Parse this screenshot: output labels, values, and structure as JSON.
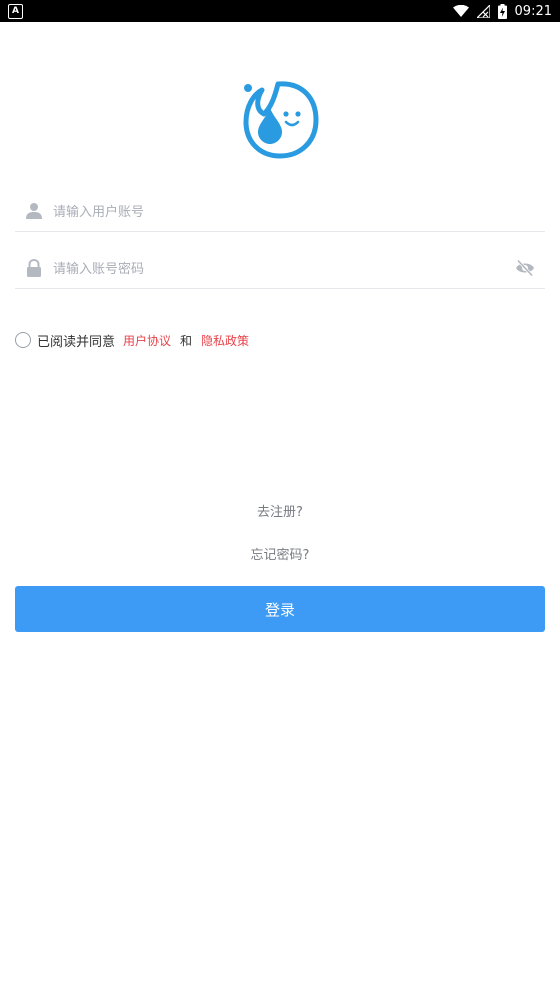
{
  "status_bar": {
    "left_indicator": "A",
    "time": "09:21",
    "icons": [
      "wifi-icon",
      "signal-icon",
      "battery-charging-icon"
    ]
  },
  "logo": {
    "icon": "water-drop-mascot-logo",
    "color": "#2a9be0"
  },
  "username": {
    "placeholder": "请输入用户账号",
    "value": "",
    "icon": "user-icon"
  },
  "password": {
    "placeholder": "请输入账号密码",
    "value": "",
    "icon": "lock-icon",
    "toggle_icon": "eye-hidden-icon"
  },
  "agreement": {
    "prefix": "已阅读并同意",
    "user_agreement": "用户协议",
    "and": "和",
    "privacy_policy": "隐私政策",
    "link_color": "#e8424a"
  },
  "links": {
    "register": "去注册?",
    "forgot_password": "忘记密码?"
  },
  "login_button": {
    "label": "登录",
    "color": "#3d9bf5"
  }
}
